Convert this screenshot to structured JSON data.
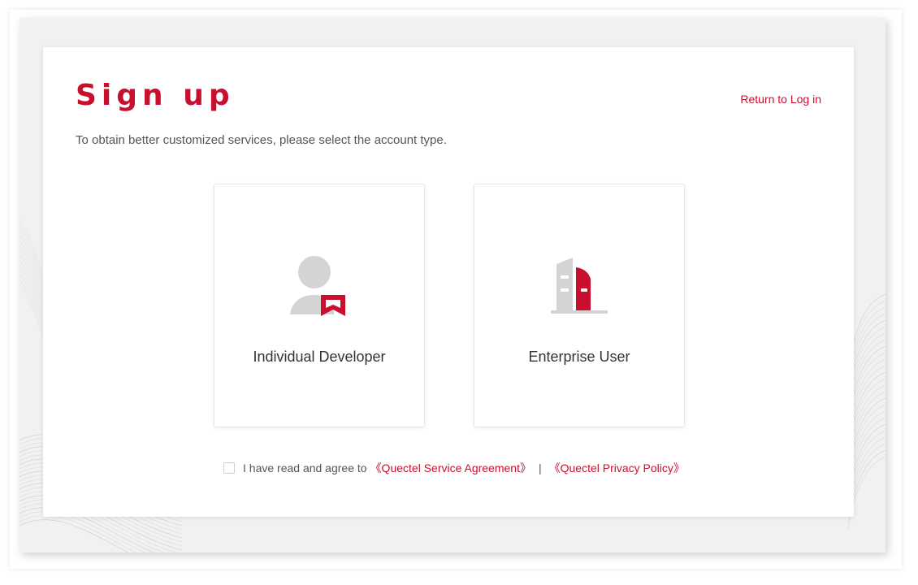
{
  "signup": {
    "title": "Sign up",
    "return_link": "Return to Log in",
    "subtitle": "To obtain better customized services, please select the account type.",
    "options": [
      {
        "label": "Individual Developer",
        "icon": "person-bookmark-icon"
      },
      {
        "label": "Enterprise User",
        "icon": "building-icon"
      }
    ],
    "agreement": {
      "prefix": "I have read and agree to",
      "service_agreement": "《Quectel Service Agreement》",
      "separator": "|",
      "privacy_policy": "《Quectel Privacy Policy》",
      "checked": false
    }
  },
  "colors": {
    "accent": "#c8102e",
    "icon_gray": "#d4d4d4",
    "background": "#f1f1f3"
  }
}
